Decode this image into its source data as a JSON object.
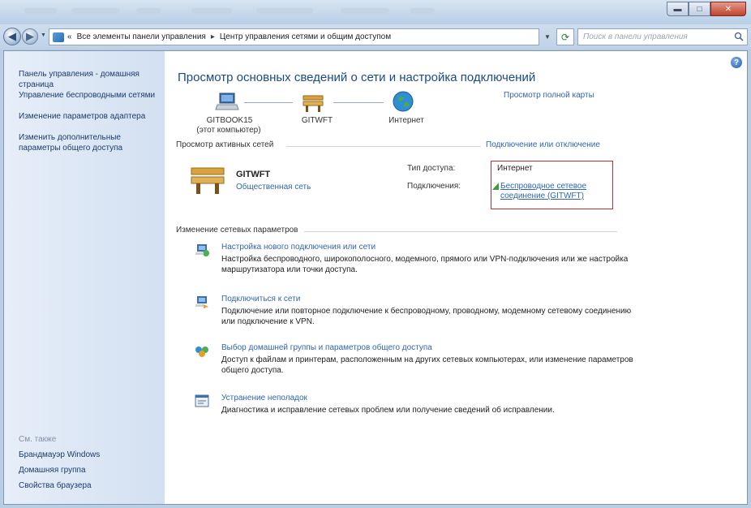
{
  "window": {
    "controls": {
      "minimize": "▬",
      "maximize": "□",
      "close": "✕"
    }
  },
  "address_bar": {
    "back": "◀",
    "forward": "▶",
    "overflow": "«",
    "crumbs": [
      "Все элементы панели управления",
      "Центр управления сетями и общим доступом"
    ],
    "search_placeholder": "Поиск в панели управления"
  },
  "sidebar": {
    "links": [
      "Панель управления - домашняя страница",
      "Управление беспроводными сетями",
      "Изменение параметров адаптера",
      "Изменить дополнительные параметры общего доступа"
    ],
    "see_also_label": "См. также",
    "see_also": [
      "Брандмауэр Windows",
      "Домашняя группа",
      "Свойства браузера"
    ]
  },
  "main": {
    "title": "Просмотр основных сведений о сети и настройка подключений",
    "full_map_link": "Просмотр полной карты",
    "nodes": {
      "computer_name": "GITBOOK15",
      "computer_sub": "(этот компьютер)",
      "network_name": "GITWFT",
      "internet_label": "Интернет"
    },
    "active_section": "Просмотр активных сетей",
    "connect_link": "Подключение или отключение",
    "active_network": {
      "name": "GITWFT",
      "type": "Общественная сеть",
      "access_label": "Тип доступа:",
      "access_value": "Интернет",
      "connections_label": "Подключения:",
      "connection_link": "Беспроводное сетевое соединение (GITWFT)"
    },
    "change_section": "Изменение сетевых параметров",
    "tasks": [
      {
        "link": "Настройка нового подключения или сети",
        "desc": "Настройка беспроводного, широкополосного, модемного, прямого или VPN-подключения или же настройка маршрутизатора или точки доступа.",
        "icon": "new-connection-icon"
      },
      {
        "link": "Подключиться к сети",
        "desc": "Подключение или повторное подключение к беспроводному, проводному, модемному сетевому соединению или подключение к VPN.",
        "icon": "connect-network-icon"
      },
      {
        "link": "Выбор домашней группы и параметров общего доступа",
        "desc": "Доступ к файлам и принтерам, расположенным на других сетевых компьютерах, или изменение параметров общего доступа.",
        "icon": "homegroup-icon"
      },
      {
        "link": "Устранение неполадок",
        "desc": "Диагностика и исправление сетевых проблем или получение сведений об исправлении.",
        "icon": "troubleshoot-icon"
      }
    ]
  },
  "colors": {
    "link": "#2f66b1",
    "title": "#1a4a88",
    "highlight_border": "#cc2a2a",
    "sidebar_bg": "#dce6f4"
  }
}
